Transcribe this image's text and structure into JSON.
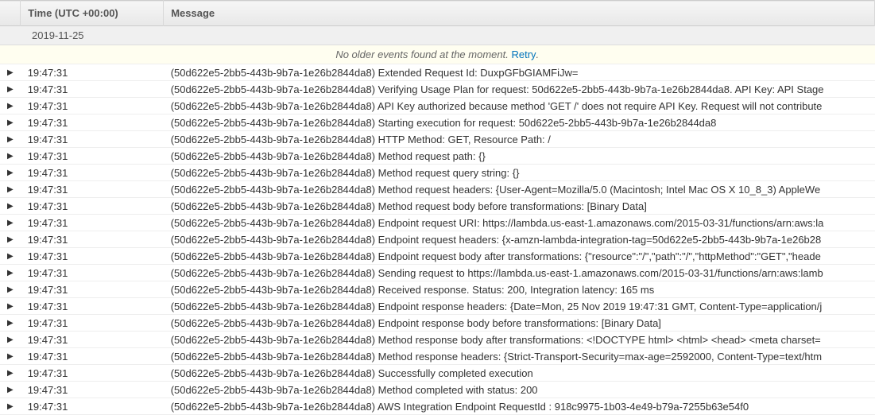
{
  "header": {
    "time_label": "Time (UTC +00:00)",
    "message_label": "Message"
  },
  "date_separator": "2019-11-25",
  "notice": {
    "text": "No older events found at the moment.",
    "retry_label": "Retry"
  },
  "request_id": "(50d622e5-2bb5-443b-9b7a-1e26b2844da8)",
  "rows": [
    {
      "time": "19:47:31",
      "msg": "(50d622e5-2bb5-443b-9b7a-1e26b2844da8) Extended Request Id: DuxpGFbGIAMFiJw="
    },
    {
      "time": "19:47:31",
      "msg": "(50d622e5-2bb5-443b-9b7a-1e26b2844da8) Verifying Usage Plan for request: 50d622e5-2bb5-443b-9b7a-1e26b2844da8. API Key: API Stage"
    },
    {
      "time": "19:47:31",
      "msg": "(50d622e5-2bb5-443b-9b7a-1e26b2844da8) API Key authorized because method 'GET /' does not require API Key. Request will not contribute"
    },
    {
      "time": "19:47:31",
      "msg": "(50d622e5-2bb5-443b-9b7a-1e26b2844da8) Starting execution for request: 50d622e5-2bb5-443b-9b7a-1e26b2844da8"
    },
    {
      "time": "19:47:31",
      "msg": "(50d622e5-2bb5-443b-9b7a-1e26b2844da8) HTTP Method: GET, Resource Path: /"
    },
    {
      "time": "19:47:31",
      "msg": "(50d622e5-2bb5-443b-9b7a-1e26b2844da8) Method request path: {}"
    },
    {
      "time": "19:47:31",
      "msg": "(50d622e5-2bb5-443b-9b7a-1e26b2844da8) Method request query string: {}"
    },
    {
      "time": "19:47:31",
      "msg": "(50d622e5-2bb5-443b-9b7a-1e26b2844da8) Method request headers: {User-Agent=Mozilla/5.0 (Macintosh; Intel Mac OS X 10_8_3) AppleWe"
    },
    {
      "time": "19:47:31",
      "msg": "(50d622e5-2bb5-443b-9b7a-1e26b2844da8) Method request body before transformations: [Binary Data]"
    },
    {
      "time": "19:47:31",
      "msg": "(50d622e5-2bb5-443b-9b7a-1e26b2844da8) Endpoint request URI: https://lambda.us-east-1.amazonaws.com/2015-03-31/functions/arn:aws:la"
    },
    {
      "time": "19:47:31",
      "msg": "(50d622e5-2bb5-443b-9b7a-1e26b2844da8) Endpoint request headers: {x-amzn-lambda-integration-tag=50d622e5-2bb5-443b-9b7a-1e26b28"
    },
    {
      "time": "19:47:31",
      "msg": "(50d622e5-2bb5-443b-9b7a-1e26b2844da8) Endpoint request body after transformations: {\"resource\":\"/\",\"path\":\"/\",\"httpMethod\":\"GET\",\"heade"
    },
    {
      "time": "19:47:31",
      "msg": "(50d622e5-2bb5-443b-9b7a-1e26b2844da8) Sending request to https://lambda.us-east-1.amazonaws.com/2015-03-31/functions/arn:aws:lamb"
    },
    {
      "time": "19:47:31",
      "msg": "(50d622e5-2bb5-443b-9b7a-1e26b2844da8) Received response. Status: 200, Integration latency: 165 ms"
    },
    {
      "time": "19:47:31",
      "msg": "(50d622e5-2bb5-443b-9b7a-1e26b2844da8) Endpoint response headers: {Date=Mon, 25 Nov 2019 19:47:31 GMT, Content-Type=application/j"
    },
    {
      "time": "19:47:31",
      "msg": "(50d622e5-2bb5-443b-9b7a-1e26b2844da8) Endpoint response body before transformations: [Binary Data]"
    },
    {
      "time": "19:47:31",
      "msg": "(50d622e5-2bb5-443b-9b7a-1e26b2844da8) Method response body after transformations: <!DOCTYPE html> <html> <head> <meta charset="
    },
    {
      "time": "19:47:31",
      "msg": "(50d622e5-2bb5-443b-9b7a-1e26b2844da8) Method response headers: {Strict-Transport-Security=max-age=2592000, Content-Type=text/htm"
    },
    {
      "time": "19:47:31",
      "msg": "(50d622e5-2bb5-443b-9b7a-1e26b2844da8) Successfully completed execution"
    },
    {
      "time": "19:47:31",
      "msg": "(50d622e5-2bb5-443b-9b7a-1e26b2844da8) Method completed with status: 200"
    },
    {
      "time": "19:47:31",
      "msg": "(50d622e5-2bb5-443b-9b7a-1e26b2844da8) AWS Integration Endpoint RequestId : 918c9975-1b03-4e49-b79a-7255b63e54f0"
    }
  ]
}
